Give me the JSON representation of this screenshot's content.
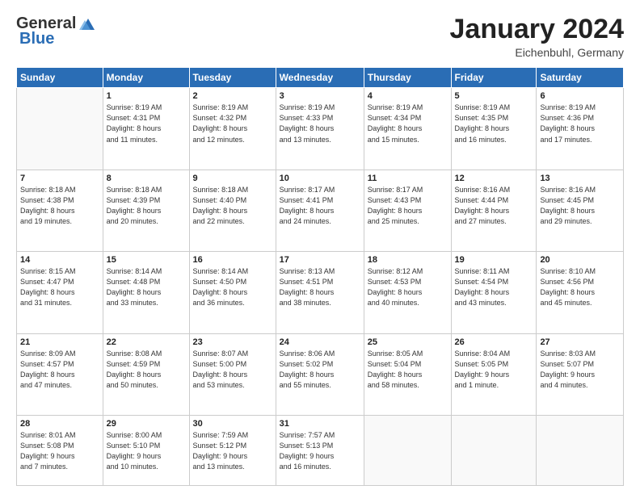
{
  "header": {
    "logo_general": "General",
    "logo_blue": "Blue",
    "month_title": "January 2024",
    "location": "Eichenbuhl, Germany"
  },
  "weekdays": [
    "Sunday",
    "Monday",
    "Tuesday",
    "Wednesday",
    "Thursday",
    "Friday",
    "Saturday"
  ],
  "weeks": [
    [
      {
        "day": "",
        "info": ""
      },
      {
        "day": "1",
        "info": "Sunrise: 8:19 AM\nSunset: 4:31 PM\nDaylight: 8 hours\nand 11 minutes."
      },
      {
        "day": "2",
        "info": "Sunrise: 8:19 AM\nSunset: 4:32 PM\nDaylight: 8 hours\nand 12 minutes."
      },
      {
        "day": "3",
        "info": "Sunrise: 8:19 AM\nSunset: 4:33 PM\nDaylight: 8 hours\nand 13 minutes."
      },
      {
        "day": "4",
        "info": "Sunrise: 8:19 AM\nSunset: 4:34 PM\nDaylight: 8 hours\nand 15 minutes."
      },
      {
        "day": "5",
        "info": "Sunrise: 8:19 AM\nSunset: 4:35 PM\nDaylight: 8 hours\nand 16 minutes."
      },
      {
        "day": "6",
        "info": "Sunrise: 8:19 AM\nSunset: 4:36 PM\nDaylight: 8 hours\nand 17 minutes."
      }
    ],
    [
      {
        "day": "7",
        "info": "Sunrise: 8:18 AM\nSunset: 4:38 PM\nDaylight: 8 hours\nand 19 minutes."
      },
      {
        "day": "8",
        "info": "Sunrise: 8:18 AM\nSunset: 4:39 PM\nDaylight: 8 hours\nand 20 minutes."
      },
      {
        "day": "9",
        "info": "Sunrise: 8:18 AM\nSunset: 4:40 PM\nDaylight: 8 hours\nand 22 minutes."
      },
      {
        "day": "10",
        "info": "Sunrise: 8:17 AM\nSunset: 4:41 PM\nDaylight: 8 hours\nand 24 minutes."
      },
      {
        "day": "11",
        "info": "Sunrise: 8:17 AM\nSunset: 4:43 PM\nDaylight: 8 hours\nand 25 minutes."
      },
      {
        "day": "12",
        "info": "Sunrise: 8:16 AM\nSunset: 4:44 PM\nDaylight: 8 hours\nand 27 minutes."
      },
      {
        "day": "13",
        "info": "Sunrise: 8:16 AM\nSunset: 4:45 PM\nDaylight: 8 hours\nand 29 minutes."
      }
    ],
    [
      {
        "day": "14",
        "info": "Sunrise: 8:15 AM\nSunset: 4:47 PM\nDaylight: 8 hours\nand 31 minutes."
      },
      {
        "day": "15",
        "info": "Sunrise: 8:14 AM\nSunset: 4:48 PM\nDaylight: 8 hours\nand 33 minutes."
      },
      {
        "day": "16",
        "info": "Sunrise: 8:14 AM\nSunset: 4:50 PM\nDaylight: 8 hours\nand 36 minutes."
      },
      {
        "day": "17",
        "info": "Sunrise: 8:13 AM\nSunset: 4:51 PM\nDaylight: 8 hours\nand 38 minutes."
      },
      {
        "day": "18",
        "info": "Sunrise: 8:12 AM\nSunset: 4:53 PM\nDaylight: 8 hours\nand 40 minutes."
      },
      {
        "day": "19",
        "info": "Sunrise: 8:11 AM\nSunset: 4:54 PM\nDaylight: 8 hours\nand 43 minutes."
      },
      {
        "day": "20",
        "info": "Sunrise: 8:10 AM\nSunset: 4:56 PM\nDaylight: 8 hours\nand 45 minutes."
      }
    ],
    [
      {
        "day": "21",
        "info": "Sunrise: 8:09 AM\nSunset: 4:57 PM\nDaylight: 8 hours\nand 47 minutes."
      },
      {
        "day": "22",
        "info": "Sunrise: 8:08 AM\nSunset: 4:59 PM\nDaylight: 8 hours\nand 50 minutes."
      },
      {
        "day": "23",
        "info": "Sunrise: 8:07 AM\nSunset: 5:00 PM\nDaylight: 8 hours\nand 53 minutes."
      },
      {
        "day": "24",
        "info": "Sunrise: 8:06 AM\nSunset: 5:02 PM\nDaylight: 8 hours\nand 55 minutes."
      },
      {
        "day": "25",
        "info": "Sunrise: 8:05 AM\nSunset: 5:04 PM\nDaylight: 8 hours\nand 58 minutes."
      },
      {
        "day": "26",
        "info": "Sunrise: 8:04 AM\nSunset: 5:05 PM\nDaylight: 9 hours\nand 1 minute."
      },
      {
        "day": "27",
        "info": "Sunrise: 8:03 AM\nSunset: 5:07 PM\nDaylight: 9 hours\nand 4 minutes."
      }
    ],
    [
      {
        "day": "28",
        "info": "Sunrise: 8:01 AM\nSunset: 5:08 PM\nDaylight: 9 hours\nand 7 minutes."
      },
      {
        "day": "29",
        "info": "Sunrise: 8:00 AM\nSunset: 5:10 PM\nDaylight: 9 hours\nand 10 minutes."
      },
      {
        "day": "30",
        "info": "Sunrise: 7:59 AM\nSunset: 5:12 PM\nDaylight: 9 hours\nand 13 minutes."
      },
      {
        "day": "31",
        "info": "Sunrise: 7:57 AM\nSunset: 5:13 PM\nDaylight: 9 hours\nand 16 minutes."
      },
      {
        "day": "",
        "info": ""
      },
      {
        "day": "",
        "info": ""
      },
      {
        "day": "",
        "info": ""
      }
    ]
  ]
}
